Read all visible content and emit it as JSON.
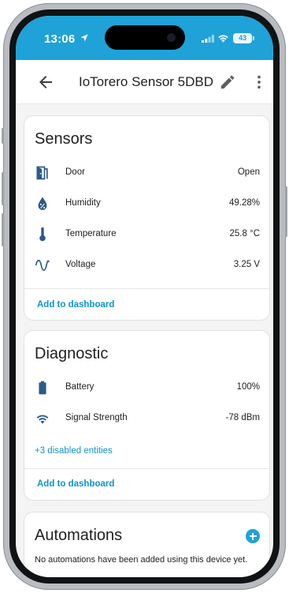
{
  "status_bar": {
    "time": "13:06",
    "battery_level": "43",
    "icons": [
      "location-arrow-icon",
      "cellular-signal-icon",
      "wifi-icon",
      "battery-icon"
    ]
  },
  "app_bar": {
    "title": "IoTorero Sensor 5DBD",
    "icons": [
      "back-arrow-icon",
      "pencil-icon",
      "more-vertical-icon"
    ]
  },
  "sensors": {
    "title": "Sensors",
    "items": [
      {
        "icon": "door-open-icon",
        "label": "Door",
        "value": "Open"
      },
      {
        "icon": "water-percent-icon",
        "label": "Humidity",
        "value": "49.28%"
      },
      {
        "icon": "thermometer-icon",
        "label": "Temperature",
        "value": "25.8 °C"
      },
      {
        "icon": "sine-wave-icon",
        "label": "Voltage",
        "value": "3.25 V"
      }
    ],
    "add_to_dashboard": "Add to dashboard"
  },
  "diagnostic": {
    "title": "Diagnostic",
    "items": [
      {
        "icon": "battery-full-icon",
        "label": "Battery",
        "value": "100%"
      },
      {
        "icon": "wifi-icon",
        "label": "Signal Strength",
        "value": "-78 dBm"
      }
    ],
    "disabled_entities": "+3 disabled entities",
    "add_to_dashboard": "Add to dashboard"
  },
  "automations": {
    "title": "Automations",
    "empty_text": "No automations have been added using this device yet.",
    "add_icon": "plus-circle-icon"
  },
  "colors": {
    "accent": "#1fa2d8",
    "link": "#0f93c9",
    "icon": "#2c5a8a",
    "background": "#f4f4f5"
  }
}
